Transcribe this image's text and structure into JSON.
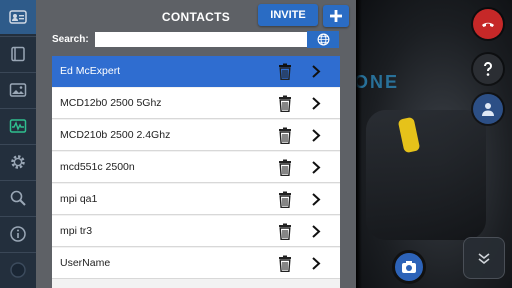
{
  "header": {
    "title": "CONTACTS",
    "invite_label": "INVITE"
  },
  "search": {
    "label": "Search:",
    "value": "",
    "placeholder": ""
  },
  "contacts": [
    {
      "name": "Ed McExpert",
      "selected": true
    },
    {
      "name": "MCD12b0 2500 5Ghz",
      "selected": false
    },
    {
      "name": "MCD210b 2500 2.4Ghz",
      "selected": false
    },
    {
      "name": "mcd551c 2500n",
      "selected": false
    },
    {
      "name": "mpi qa1",
      "selected": false
    },
    {
      "name": "mpi tr3",
      "selected": false
    },
    {
      "name": "UserName",
      "selected": false
    }
  ],
  "sidebar": {
    "items": [
      {
        "icon": "contacts-card-icon",
        "active": true
      },
      {
        "icon": "book-icon",
        "active": false
      },
      {
        "icon": "image-icon",
        "active": false
      },
      {
        "icon": "waveform-icon",
        "active": false
      },
      {
        "icon": "gear-icon",
        "active": false
      },
      {
        "icon": "search-icon",
        "active": false
      },
      {
        "icon": "info-icon",
        "active": false
      },
      {
        "icon": "globe-icon",
        "active": false
      }
    ]
  },
  "background_text": "ONE",
  "colors": {
    "accent": "#2a6cc4",
    "selected_row": "#2f6dd0",
    "panel": "#5e6166",
    "sidebar": "#232f3d",
    "end_call": "#c62828"
  }
}
